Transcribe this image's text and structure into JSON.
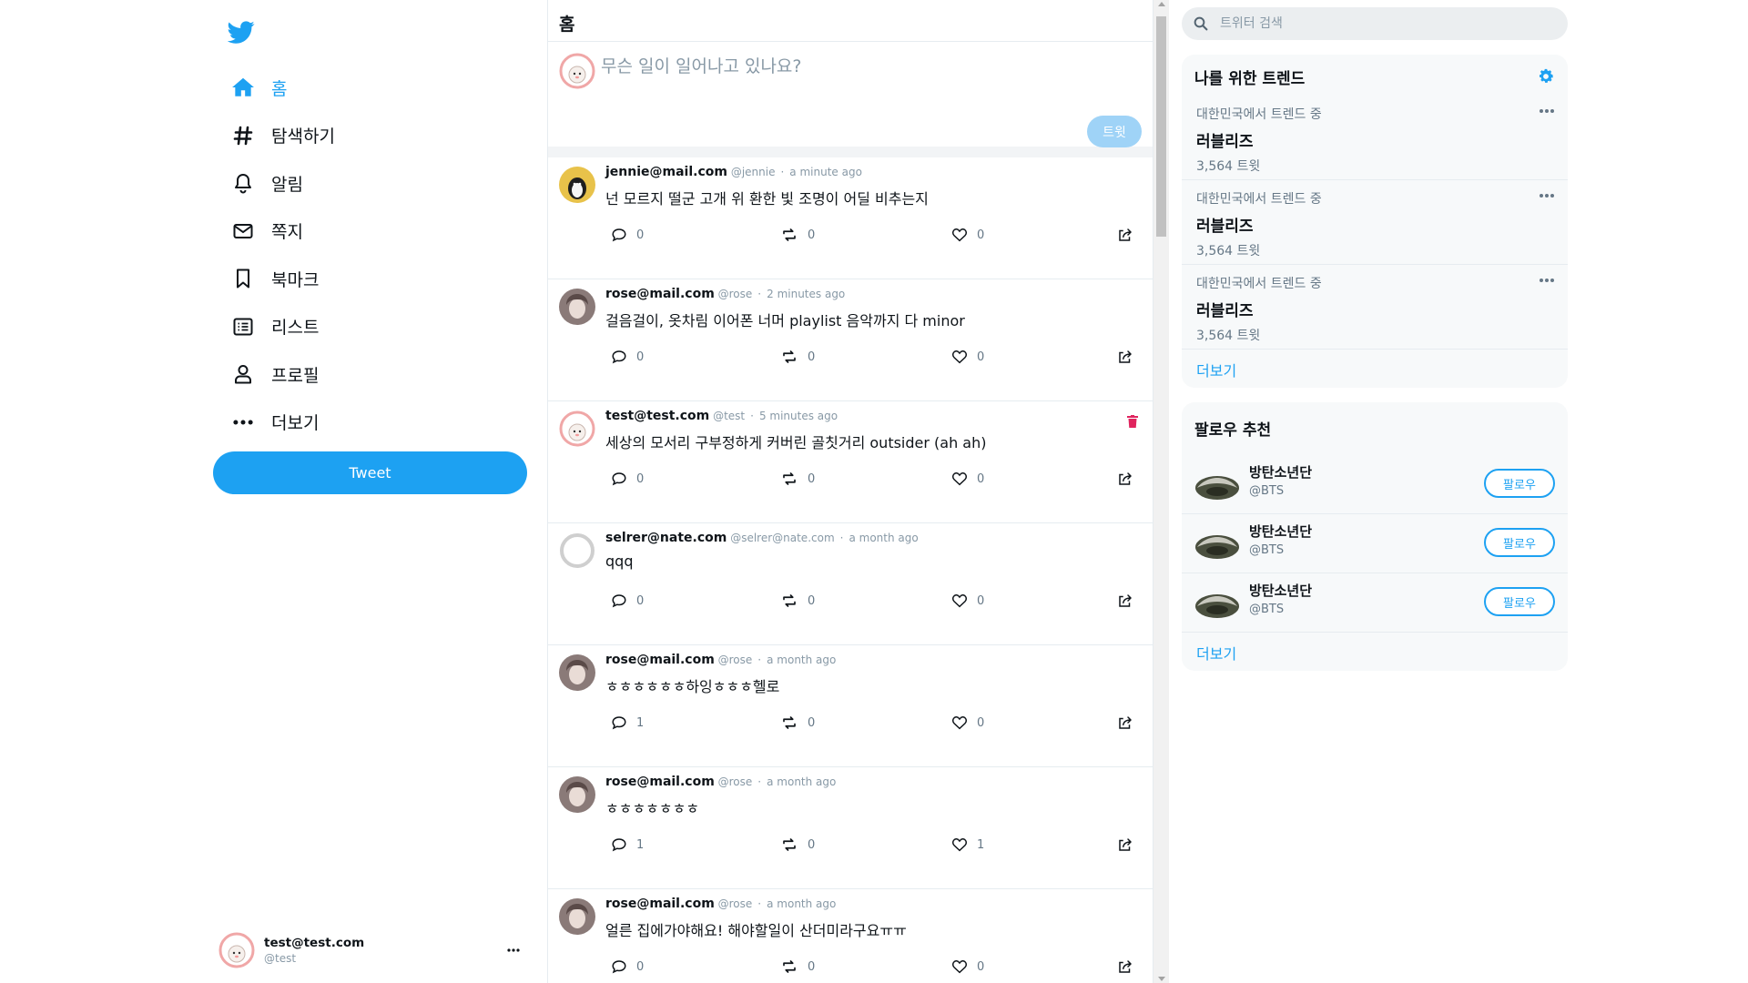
{
  "colors": {
    "accent": "#1da1f2",
    "delete": "#e0245e",
    "muted": "#8899a6"
  },
  "sidebar": {
    "logo_icon": "twitter-bird-icon",
    "items": [
      {
        "label": "홈",
        "icon": "home-icon",
        "active": true
      },
      {
        "label": "탐색하기",
        "icon": "hashtag-icon"
      },
      {
        "label": "알림",
        "icon": "bell-icon"
      },
      {
        "label": "쪽지",
        "icon": "mail-icon"
      },
      {
        "label": "북마크",
        "icon": "bookmark-icon"
      },
      {
        "label": "리스트",
        "icon": "list-icon"
      },
      {
        "label": "프로필",
        "icon": "profile-icon"
      },
      {
        "label": "더보기",
        "icon": "more-dots-icon"
      }
    ],
    "tweet_button": "Tweet",
    "account": {
      "name": "test@test.com",
      "handle": "@test"
    }
  },
  "main": {
    "title": "홈",
    "composer": {
      "placeholder": "무슨 일이 일어나고 있나요?",
      "submit": "트윗"
    },
    "tweets": [
      {
        "author": "jennie@mail.com",
        "handle": "@jennie",
        "time": "a minute ago",
        "text": "넌 모르지 떨군 고개 위 환한 빛 조명이 어딜 비추는지",
        "replies": "0",
        "retweets": "0",
        "likes": "0"
      },
      {
        "author": "rose@mail.com",
        "handle": "@rose",
        "time": "2 minutes ago",
        "text": "걸음걸이, 옷차림 이어폰 너머 playlist 음악까지 다 minor",
        "replies": "0",
        "retweets": "0",
        "likes": "0"
      },
      {
        "author": "test@test.com",
        "handle": "@test",
        "time": "5 minutes ago",
        "text": "세상의 모서리 구부정하게 커버린 골칫거리 outsider (ah ah)",
        "replies": "0",
        "retweets": "0",
        "likes": "0",
        "own": true
      },
      {
        "author": "selrer@nate.com",
        "handle": "@selrer@nate.com",
        "time": "a month ago",
        "text": "qqq",
        "replies": "0",
        "retweets": "0",
        "likes": "0"
      },
      {
        "author": "rose@mail.com",
        "handle": "@rose",
        "time": "a month ago",
        "text": "ㅎㅎㅎㅎㅎㅎ하잉ㅎㅎㅎ헬로",
        "replies": "1",
        "retweets": "0",
        "likes": "0"
      },
      {
        "author": "rose@mail.com",
        "handle": "@rose",
        "time": "a month ago",
        "text": "ㅎㅎㅎㅎㅎㅎㅎ",
        "replies": "1",
        "retweets": "0",
        "likes": "1"
      },
      {
        "author": "rose@mail.com",
        "handle": "@rose",
        "time": "a month ago",
        "text": "얼른 집에가야해요! 해야할일이 산더미라구요ㅠㅠ",
        "replies": "0",
        "retweets": "0",
        "likes": "0"
      }
    ]
  },
  "search": {
    "placeholder": "트위터 검색"
  },
  "trends": {
    "title": "나를 위한 트렌드",
    "items": [
      {
        "context": "대한민국에서 트렌드 중",
        "name": "러블리즈",
        "count": "3,564 트윗"
      },
      {
        "context": "대한민국에서 트렌드 중",
        "name": "러블리즈",
        "count": "3,564 트윗"
      },
      {
        "context": "대한민국에서 트렌드 중",
        "name": "러블리즈",
        "count": "3,564 트윗"
      }
    ],
    "more": "더보기"
  },
  "follow": {
    "title": "팔로우 추천",
    "items": [
      {
        "name": "방탄소년단",
        "handle": "@BTS",
        "button": "팔로우"
      },
      {
        "name": "방탄소년단",
        "handle": "@BTS",
        "button": "팔로우"
      },
      {
        "name": "방탄소년단",
        "handle": "@BTS",
        "button": "팔로우"
      }
    ],
    "more": "더보기"
  }
}
